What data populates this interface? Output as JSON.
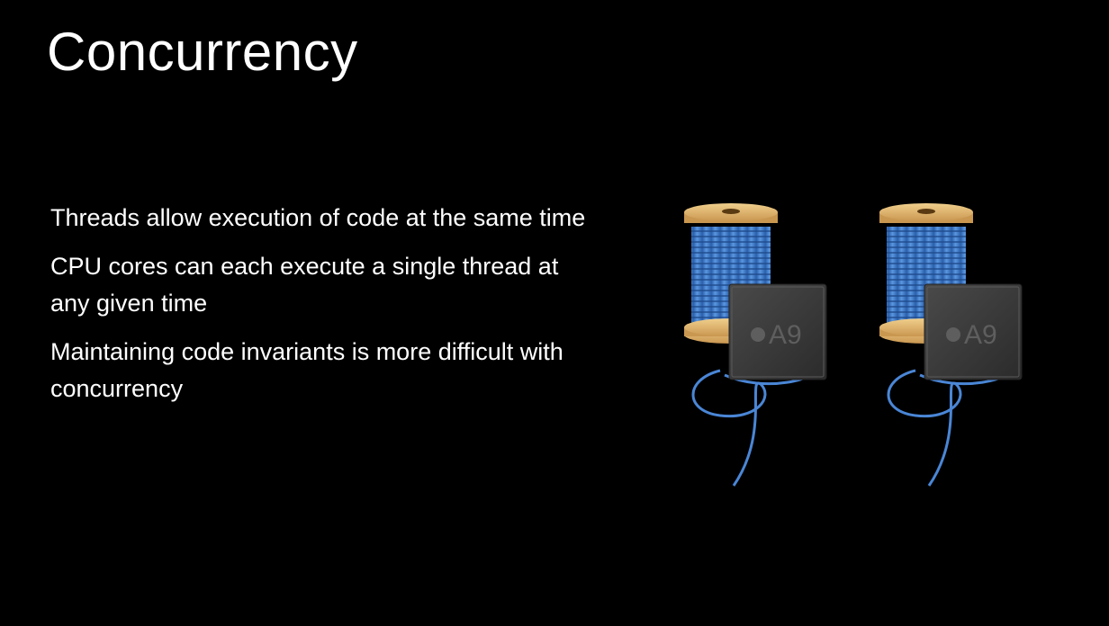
{
  "slide": {
    "title": "Concurrency",
    "bullets": [
      "Threads allow execution of code at the same time",
      "CPU cores can each execute a single thread at any given time",
      "Maintaining code invariants is more difficult with concurrency"
    ]
  },
  "illustration": {
    "chip_label": "A9",
    "colors": {
      "thread": "#3b78c8",
      "spool_wood": "#e2b56d",
      "chip": "#3c3c3c",
      "background": "#000000"
    }
  }
}
